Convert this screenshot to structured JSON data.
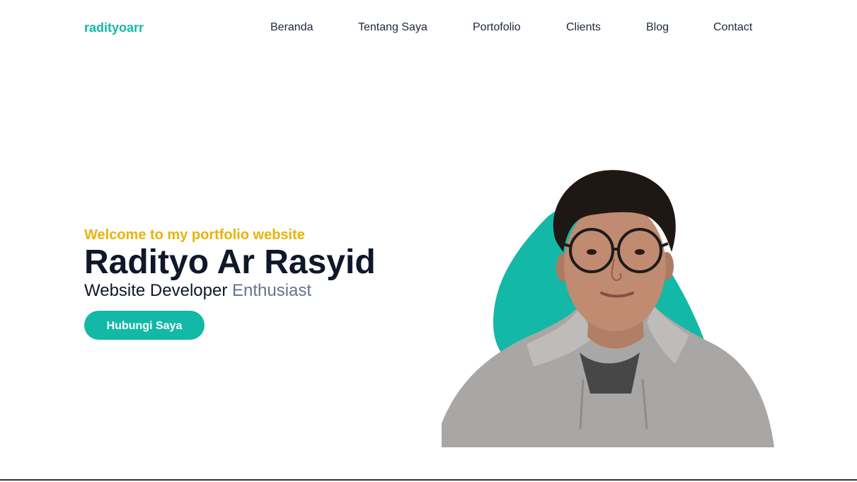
{
  "nav": {
    "brand": "radityoarr",
    "links": [
      {
        "label": "Beranda"
      },
      {
        "label": "Tentang Saya"
      },
      {
        "label": "Portofolio"
      },
      {
        "label": "Clients"
      },
      {
        "label": "Blog"
      },
      {
        "label": "Contact"
      }
    ]
  },
  "hero": {
    "eyebrow": "Welcome to my portfolio website",
    "name": "Radityo Ar Rasyid",
    "role_main": "Website Developer",
    "role_muted": "Enthusiast",
    "cta_label": "Hubungi Saya"
  },
  "colors": {
    "accent": "#14b8a6",
    "eyebrow": "#eab308",
    "heading": "#0f172a",
    "muted": "#64748b"
  }
}
